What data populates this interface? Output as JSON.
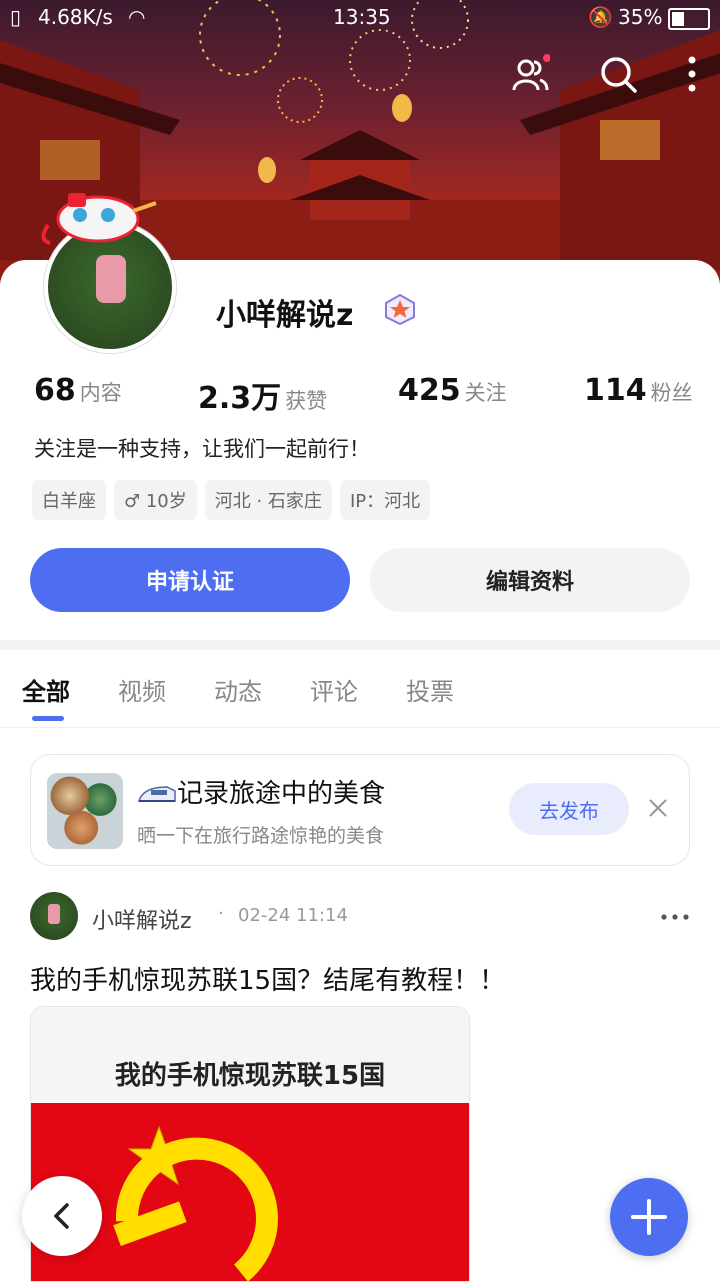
{
  "status_bar": {
    "speed": "4.68K/s",
    "time": "13:35",
    "battery": "35%"
  },
  "profile": {
    "name": "小咩解说z",
    "stats": [
      {
        "num": "68",
        "label": "内容"
      },
      {
        "num": "2.3万",
        "label": "获赞"
      },
      {
        "num": "425",
        "label": "关注"
      },
      {
        "num": "114",
        "label": "粉丝"
      }
    ],
    "bio": "关注是一种支持，让我们一起前行！",
    "tags": [
      "白羊座",
      "♂ 10岁",
      "河北 · 石家庄",
      "IP：河北"
    ],
    "apply_button": "申请认证",
    "edit_button": "编辑资料"
  },
  "tabs": [
    "全部",
    "视频",
    "动态",
    "评论",
    "投票"
  ],
  "promo": {
    "title": "记录旅途中的美食",
    "subtitle": "晒一下在旅行路途惊艳的美食",
    "button": "去发布"
  },
  "post": {
    "author": "小咩解说z",
    "dot": "·",
    "time": "02-24 11:14",
    "text": "我的手机惊现苏联15国？结尾有教程！！",
    "image_caption": "我的手机惊现苏联15国"
  },
  "colors": {
    "accent": "#4e6ef2",
    "red": "#e30613"
  }
}
